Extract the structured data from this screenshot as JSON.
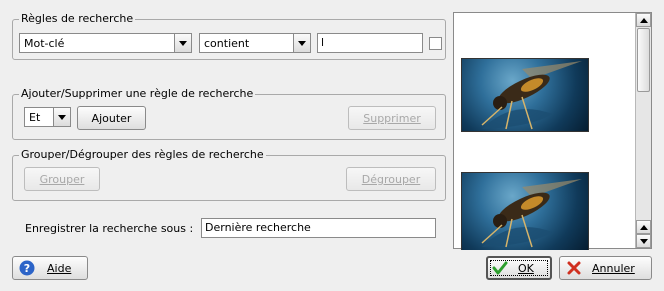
{
  "rules_group": {
    "title": "Règles de recherche",
    "field_value": "Mot-clé",
    "operator_value": "contient",
    "text_value": "l"
  },
  "add_remove_group": {
    "title": "Ajouter/Supprimer une règle de recherche",
    "logic_value": "Et",
    "add_label": "Ajouter",
    "remove_label": "Supprimer"
  },
  "group_ungroup_group": {
    "title": "Grouper/Dégrouper des règles de recherche",
    "group_label": "Grouper",
    "ungroup_label": "Dégrouper"
  },
  "save_search": {
    "label": "Enregistrer la recherche sous :",
    "value": "Dernière recherche"
  },
  "footer": {
    "help_label": "Aide",
    "ok_label": "OK",
    "cancel_label": "Annuler"
  },
  "icons": {
    "help": "help-icon",
    "ok": "checkmark-icon",
    "cancel": "cancel-x-icon"
  },
  "colors": {
    "help_blue": "#2c64c8",
    "ok_green": "#2e9e2e",
    "cancel_red": "#d03020"
  }
}
